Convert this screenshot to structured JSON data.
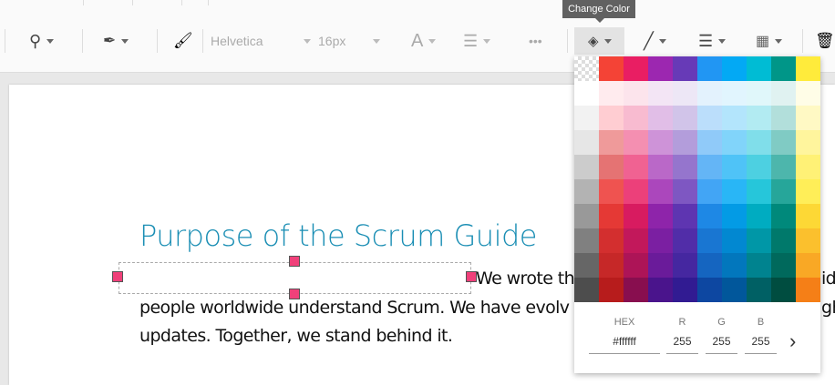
{
  "tooltip": "Change Color",
  "toolbar": {
    "font": "Helvetica",
    "size": "16px",
    "text_color_icon": "A"
  },
  "palette": {
    "rows": [
      [
        "transparent",
        "#f44336",
        "#e91e63",
        "#9c27b0",
        "#673ab7",
        "#2196f3",
        "#03a9f4",
        "#00bcd4",
        "#009688",
        "#ffeb3b"
      ],
      [
        "#ffffff",
        "#ffebee",
        "#fce4ec",
        "#f3e5f5",
        "#ede7f6",
        "#e3f2fd",
        "#e1f5fe",
        "#e0f7fa",
        "#e0f2f1",
        "#fffde7"
      ],
      [
        "#f2f2f2",
        "#ffcdd2",
        "#f8bbd0",
        "#e1bee7",
        "#d1c4e9",
        "#bbdefb",
        "#b3e5fc",
        "#b2ebf2",
        "#b2dfdb",
        "#fff9c4"
      ],
      [
        "#e6e6e6",
        "#ef9a9a",
        "#f48fb1",
        "#ce93d8",
        "#b39ddb",
        "#90caf9",
        "#81d4fa",
        "#80deea",
        "#80cbc4",
        "#fff59d"
      ],
      [
        "#cccccc",
        "#e57373",
        "#f06292",
        "#ba68c8",
        "#9575cd",
        "#64b5f6",
        "#4fc3f7",
        "#4dd0e1",
        "#4db6ac",
        "#fff176"
      ],
      [
        "#b3b3b3",
        "#ef5350",
        "#ec407a",
        "#ab47bc",
        "#7e57c2",
        "#42a5f5",
        "#29b6f6",
        "#26c6da",
        "#26a69a",
        "#ffee58"
      ],
      [
        "#999999",
        "#e53935",
        "#d81b60",
        "#8e24aa",
        "#5e35b1",
        "#1e88e5",
        "#039be5",
        "#00acc1",
        "#00897b",
        "#fdd835"
      ],
      [
        "#808080",
        "#d32f2f",
        "#c2185b",
        "#7b1fa2",
        "#512da8",
        "#1976d2",
        "#0288d1",
        "#0097a7",
        "#00796b",
        "#fbc02d"
      ],
      [
        "#666666",
        "#c62828",
        "#ad1457",
        "#6a1b9a",
        "#4527a0",
        "#1565c0",
        "#0277bd",
        "#00838f",
        "#00695c",
        "#f9a825"
      ],
      [
        "#4d4d4d",
        "#b71c1c",
        "#880e4f",
        "#4a148c",
        "#311b92",
        "#0d47a1",
        "#01579b",
        "#006064",
        "#004d40",
        "#f57f17"
      ]
    ],
    "hex_label": "HEX",
    "hex": "#ffffff",
    "r_label": "R",
    "r": "255",
    "g_label": "G",
    "g": "255",
    "b_label": "B",
    "b": "255",
    "next": "›"
  },
  "document": {
    "heading": "Purpose of the Scrum Guide",
    "line1": "We wrote th",
    "line1_right": "id",
    "line2": "people worldwide understand Scrum.  We have evolv",
    "line2_right": "gh",
    "line3": "updates. Together, we stand behind it."
  }
}
